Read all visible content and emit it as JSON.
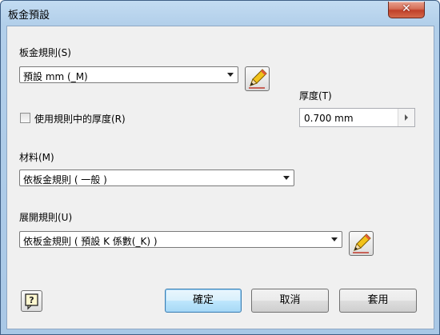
{
  "window": {
    "title": "板金預設",
    "close_glyph": "✕"
  },
  "sheet_metal_rule": {
    "label": "板金規則(S)",
    "value": "預設 mm (_M)"
  },
  "thickness": {
    "label": "厚度(T)",
    "value": "0.700 mm"
  },
  "use_rule_thickness": {
    "label": "使用規則中的厚度(R)",
    "checked": false
  },
  "material": {
    "label": "材料(M)",
    "value": "依板金規則 ( 一般 )"
  },
  "unfold_rule": {
    "label": "展開規則(U)",
    "value": "依板金規則 ( 預設 K 係數(_K) )"
  },
  "buttons": {
    "ok": "確定",
    "cancel": "取消",
    "apply": "套用"
  },
  "icons": {
    "edit": "pencil-icon",
    "help": "help-icon",
    "close": "close-icon"
  },
  "colors": {
    "title_bar": "#b9d4ee",
    "close_button": "#c7472f",
    "client_bg": "#f0f0f0",
    "default_button": "#bee6fd"
  }
}
